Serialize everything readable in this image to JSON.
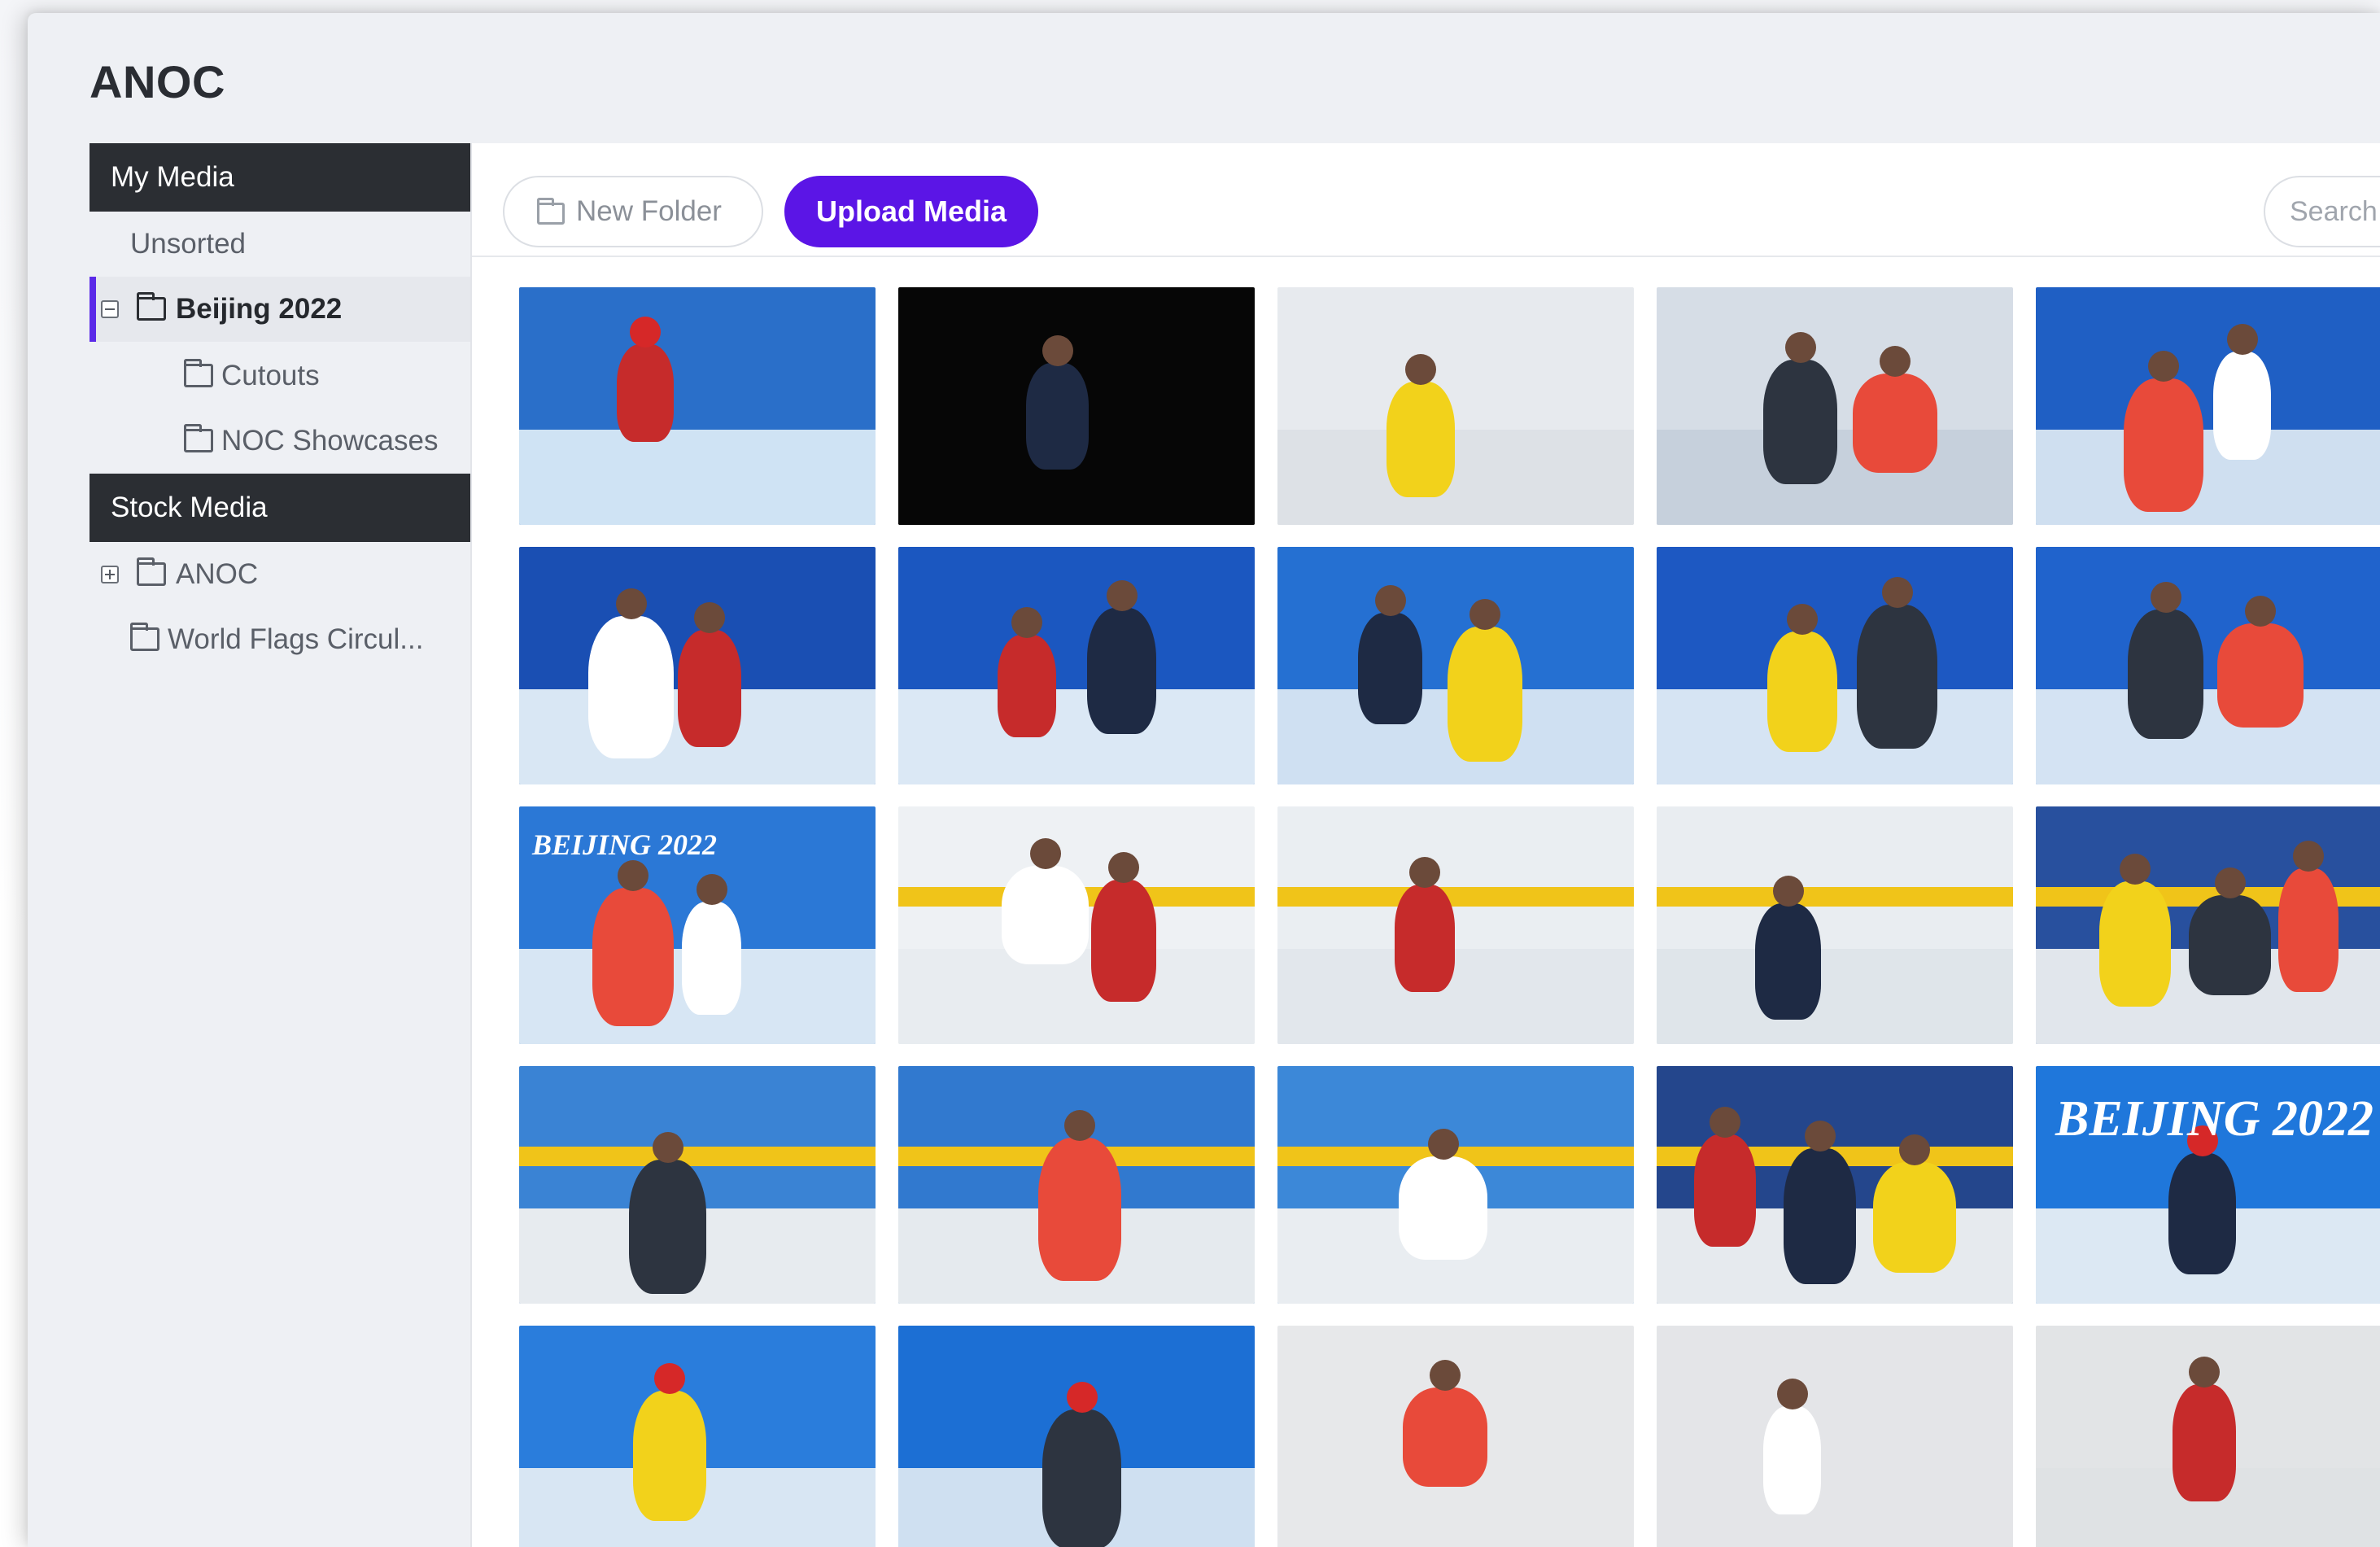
{
  "app": {
    "title": "ANOC"
  },
  "sidebar": {
    "my_media": "My Media",
    "unsorted": "Unsorted",
    "folders": [
      {
        "label": "Beijing 2022",
        "active": true,
        "expanded": true
      },
      {
        "label": "Cutouts"
      },
      {
        "label": "NOC Showcases"
      }
    ],
    "stock_media": "Stock Media",
    "stock_folders": [
      {
        "label": "ANOC",
        "expanded": false
      },
      {
        "label": "World Flags Circul..."
      }
    ]
  },
  "toolbar": {
    "new_folder": "New Folder",
    "upload_media": "Upload Media",
    "search_placeholder": "Search M"
  },
  "colors": {
    "accent": "#5b15e6",
    "sidebar_header": "#2b2e33",
    "active_marker": "#5b2ae8"
  },
  "grid": {
    "captions": {
      "r4c5": "BEIJING 2022",
      "r3c1": "BEIJING 2022"
    },
    "tiles": [
      {
        "scene": "speed-skating-celebration",
        "bg": "#2a6fc9",
        "ice": "#cfe3f4"
      },
      {
        "scene": "ski-jump-night",
        "bg": "#060606",
        "ice": "#060606"
      },
      {
        "scene": "freestyle-medal-red",
        "bg": "#e7eaee",
        "ice": "#dde1e6"
      },
      {
        "scene": "figure-skating-pair",
        "bg": "#d6dde6",
        "ice": "#c6d0dc"
      },
      {
        "scene": "figure-skating-lift-blue",
        "bg": "#1f5fc4",
        "ice": "#cfdff0"
      },
      {
        "scene": "figure-skating-lift",
        "bg": "#1a4fb3",
        "ice": "#d9e7f4"
      },
      {
        "scene": "figure-skating-spin",
        "bg": "#1b57c0",
        "ice": "#dbe8f5"
      },
      {
        "scene": "figure-skating-embrace",
        "bg": "#2570d2",
        "ice": "#cfe0f2"
      },
      {
        "scene": "figure-skating-overhead",
        "bg": "#1d58c2",
        "ice": "#d6e4f3"
      },
      {
        "scene": "figure-skating-olympic-rings",
        "bg": "#2063cc",
        "ice": "#d4e3f3"
      },
      {
        "scene": "figure-skating-death-spiral",
        "bg": "#2b78d6",
        "ice": "#d7e6f4"
      },
      {
        "scene": "ice-hockey-sweden-canada",
        "bg": "#eef1f4",
        "ice": "#e8ecf0"
      },
      {
        "scene": "ice-hockey-sweden-forward",
        "bg": "#eaeef2",
        "ice": "#e2e7ec"
      },
      {
        "scene": "ice-hockey-sweden-rush",
        "bg": "#e9edf1",
        "ice": "#dfe5ea"
      },
      {
        "scene": "ice-hockey-usa-finland",
        "bg": "#28509e",
        "ice": "#e1e6ec"
      },
      {
        "scene": "ice-hockey-sweden-boards",
        "bg": "#3a83d4",
        "ice": "#e7ebef"
      },
      {
        "scene": "ice-hockey-sweden-stick",
        "bg": "#3179cf",
        "ice": "#e5eaee"
      },
      {
        "scene": "ice-hockey-usa-skater",
        "bg": "#3c88d8",
        "ice": "#e9edf1"
      },
      {
        "scene": "ice-hockey-canada-team",
        "bg": "#24468c",
        "ice": "#e6eaee"
      },
      {
        "scene": "speed-skating-red-helmet",
        "bg": "#1f77db",
        "ice": "#dce8f3"
      },
      {
        "scene": "speed-skating-red-lean",
        "bg": "#2a7ddc",
        "ice": "#d8e6f3"
      },
      {
        "scene": "speed-skating-closeup",
        "bg": "#1c6fd4",
        "ice": "#cfe0f1"
      },
      {
        "scene": "freestyle-aerial-grey-1",
        "bg": "#e7e8ea",
        "ice": "#e7e8ea"
      },
      {
        "scene": "freestyle-aerial-grey-2",
        "bg": "#e4e5e8",
        "ice": "#e4e5e8"
      },
      {
        "scene": "freestyle-aerial-grey-3",
        "bg": "#e2e4e6",
        "ice": "#dfe2e4"
      }
    ]
  }
}
